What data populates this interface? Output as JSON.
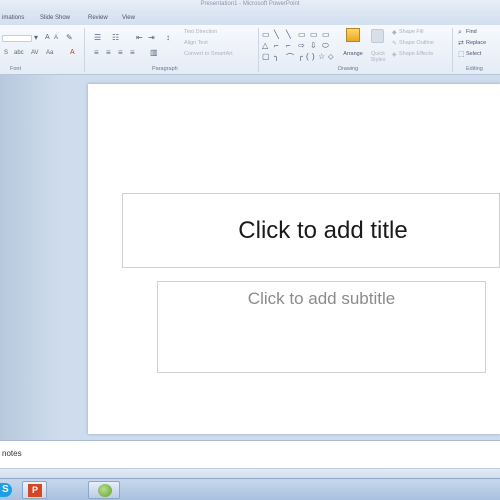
{
  "window": {
    "title": "Presentation1 - Microsoft PowerPoint"
  },
  "ribbon": {
    "tabs": [
      {
        "label": "imations"
      },
      {
        "label": "Slide Show"
      },
      {
        "label": "Review"
      },
      {
        "label": "View"
      }
    ],
    "groups": {
      "font": "Font",
      "paragraph": "Paragraph",
      "drawing": "Drawing",
      "editing": "Editing"
    },
    "paragraph_commands": {
      "text_direction": "Text Direction",
      "align_text": "Align Text",
      "convert_smartart": "Convert to SmartArt"
    },
    "drawing_commands": {
      "arrange": "Arrange",
      "quick_styles": "Quick Styles",
      "shape_fill": "Shape Fill",
      "shape_outline": "Shape Outline",
      "shape_effects": "Shape Effects"
    },
    "editing_commands": {
      "find": "Find",
      "replace": "Replace",
      "select": "Select"
    }
  },
  "slide": {
    "title_placeholder": "Click to add title",
    "subtitle_placeholder": "Click to add subtitle"
  },
  "notes": {
    "placeholder": "notes"
  },
  "icons": {
    "shapes": [
      "▭",
      "╲",
      "╲",
      "▭",
      "▭",
      "▭",
      "△",
      "⌐",
      "⌐",
      "⇨",
      "⇩",
      "⬭",
      "▢",
      "╮",
      "⌒",
      "╭",
      "(",
      ")",
      "☆",
      "⬦"
    ]
  },
  "taskbar": {
    "skype_letter": "S",
    "powerpoint_letter": "P"
  }
}
